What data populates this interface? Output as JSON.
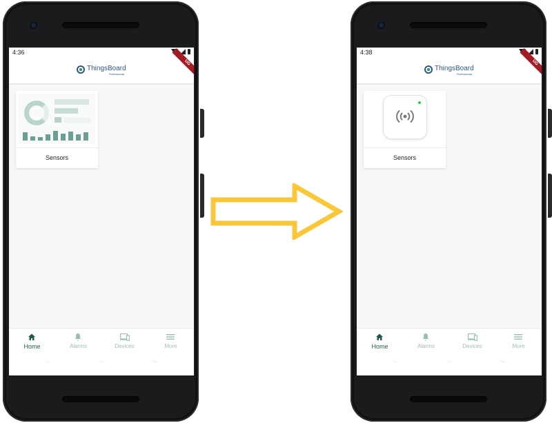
{
  "colors": {
    "brand_primary": "#305680",
    "accent_green": "#2a9c6b",
    "nav_active": "#255a50",
    "nav_inactive": "#9bbeb6",
    "arrow_fill": "#fbc73a",
    "debug_ribbon": "#a31d24"
  },
  "phones": {
    "left": {
      "status_time": "4:36",
      "brand": "ThingsBoard",
      "brand_sub": "Professional",
      "debug_badge": "UG",
      "tile_label": "Sensors",
      "tile_image": "dashboard-preview-thumbnail",
      "nav": {
        "home": "Home",
        "alarms": "Alarms",
        "devices": "Devices",
        "more": "More"
      }
    },
    "right": {
      "status_time": "4:38",
      "brand": "ThingsBoard",
      "brand_sub": "Professional",
      "debug_badge": "UG",
      "tile_label": "Sensors",
      "tile_image": "sensor-broadcast-icon",
      "nav": {
        "home": "Home",
        "alarms": "Alarms",
        "devices": "Devices",
        "more": "More"
      }
    }
  },
  "transition": {
    "icon": "arrow-right-icon"
  }
}
